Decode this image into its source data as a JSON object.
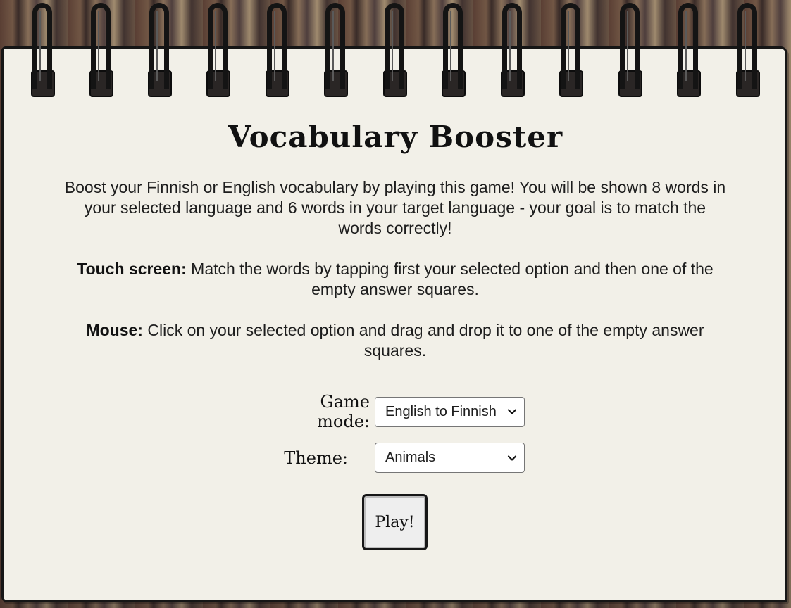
{
  "app": {
    "title": "Vocabulary Booster"
  },
  "instructions": {
    "intro": "Boost your Finnish or English vocabulary by playing this game! You will be shown 8 words in your selected language and 6 words in your target language - your goal is to match the words correctly!",
    "touch_label": "Touch screen:",
    "touch_text": " Match the words by tapping first your selected option and then one of the empty answer squares.",
    "mouse_label": "Mouse:",
    "mouse_text": " Click on your selected option and drag and drop it to one of the empty answer squares."
  },
  "form": {
    "game_mode_label": "Game mode:",
    "game_mode_value": "English to Finnish",
    "theme_label": "Theme:",
    "theme_value": "Animals",
    "play_label": "Play!"
  },
  "icons": {
    "dropdown": "chevron-down-icon",
    "rings": "spiral-ring-icon"
  },
  "colors": {
    "paper": "#f2f0e8",
    "ink": "#111111",
    "border": "#161616"
  }
}
